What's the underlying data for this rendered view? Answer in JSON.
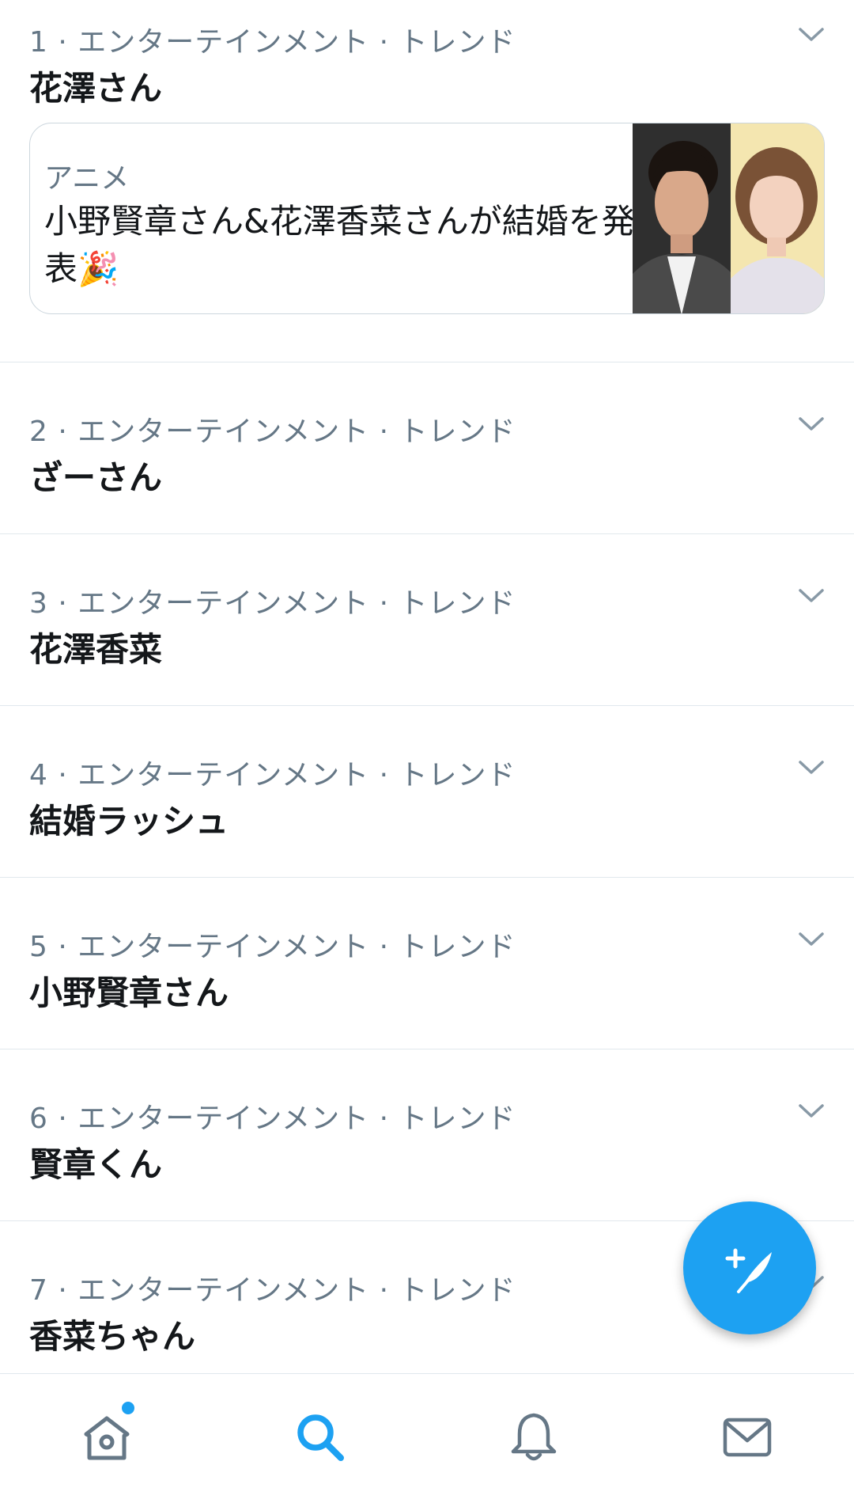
{
  "colors": {
    "accent": "#1da1f2",
    "text_primary": "#14171a",
    "text_secondary": "#657786",
    "divider": "#e1e8ed"
  },
  "trends": [
    {
      "meta": "1 · エンターテインメント · トレンド",
      "title": "花澤さん",
      "card": {
        "category": "アニメ",
        "headline": "小野賢章さん&花澤香菜さんが結婚を発表🎉"
      }
    },
    {
      "meta": "2 · エンターテインメント · トレンド",
      "title": "ざーさん"
    },
    {
      "meta": "3 · エンターテインメント · トレンド",
      "title": "花澤香菜"
    },
    {
      "meta": "4 · エンターテインメント · トレンド",
      "title": "結婚ラッシュ"
    },
    {
      "meta": "5 · エンターテインメント · トレンド",
      "title": "小野賢章さん"
    },
    {
      "meta": "6 · エンターテインメント · トレンド",
      "title": "賢章くん"
    },
    {
      "meta": "7 · エンターテインメント · トレンド",
      "title": "香菜ちゃん"
    }
  ],
  "icons": {
    "chevron": "chevron-down-icon",
    "compose": "compose-tweet-icon",
    "home": "home-icon",
    "search": "search-icon",
    "notifications": "bell-icon",
    "messages": "mail-icon"
  },
  "bottom_nav": {
    "active": "search",
    "home_has_new": true
  }
}
